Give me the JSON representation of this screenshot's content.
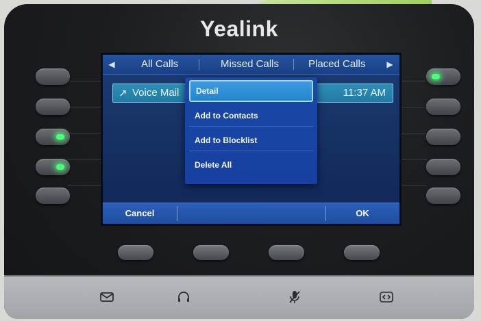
{
  "brand": "Yealink",
  "tabs": [
    "All Calls",
    "Missed Calls",
    "Placed Calls"
  ],
  "call_row": {
    "arrow": "↗",
    "name": "Voice Mail",
    "time": "11:37 AM"
  },
  "menu": {
    "items": [
      "Detail",
      "Add to Contacts",
      "Add to Blocklist",
      "Delete All"
    ],
    "selected_index": 0
  },
  "softkeys": {
    "left": "Cancel",
    "right": "OK"
  },
  "leds": {
    "left": [
      false,
      false,
      true,
      true,
      false
    ],
    "right": [
      true,
      false,
      false,
      false,
      false
    ]
  },
  "strip_icons": [
    "envelope-icon",
    "headset-icon",
    "mute-microphone-icon",
    "transfer-icon"
  ],
  "colors": {
    "led_green": "#4cff7a",
    "screen_blue": "#173366",
    "highlight": "#2584cf"
  }
}
